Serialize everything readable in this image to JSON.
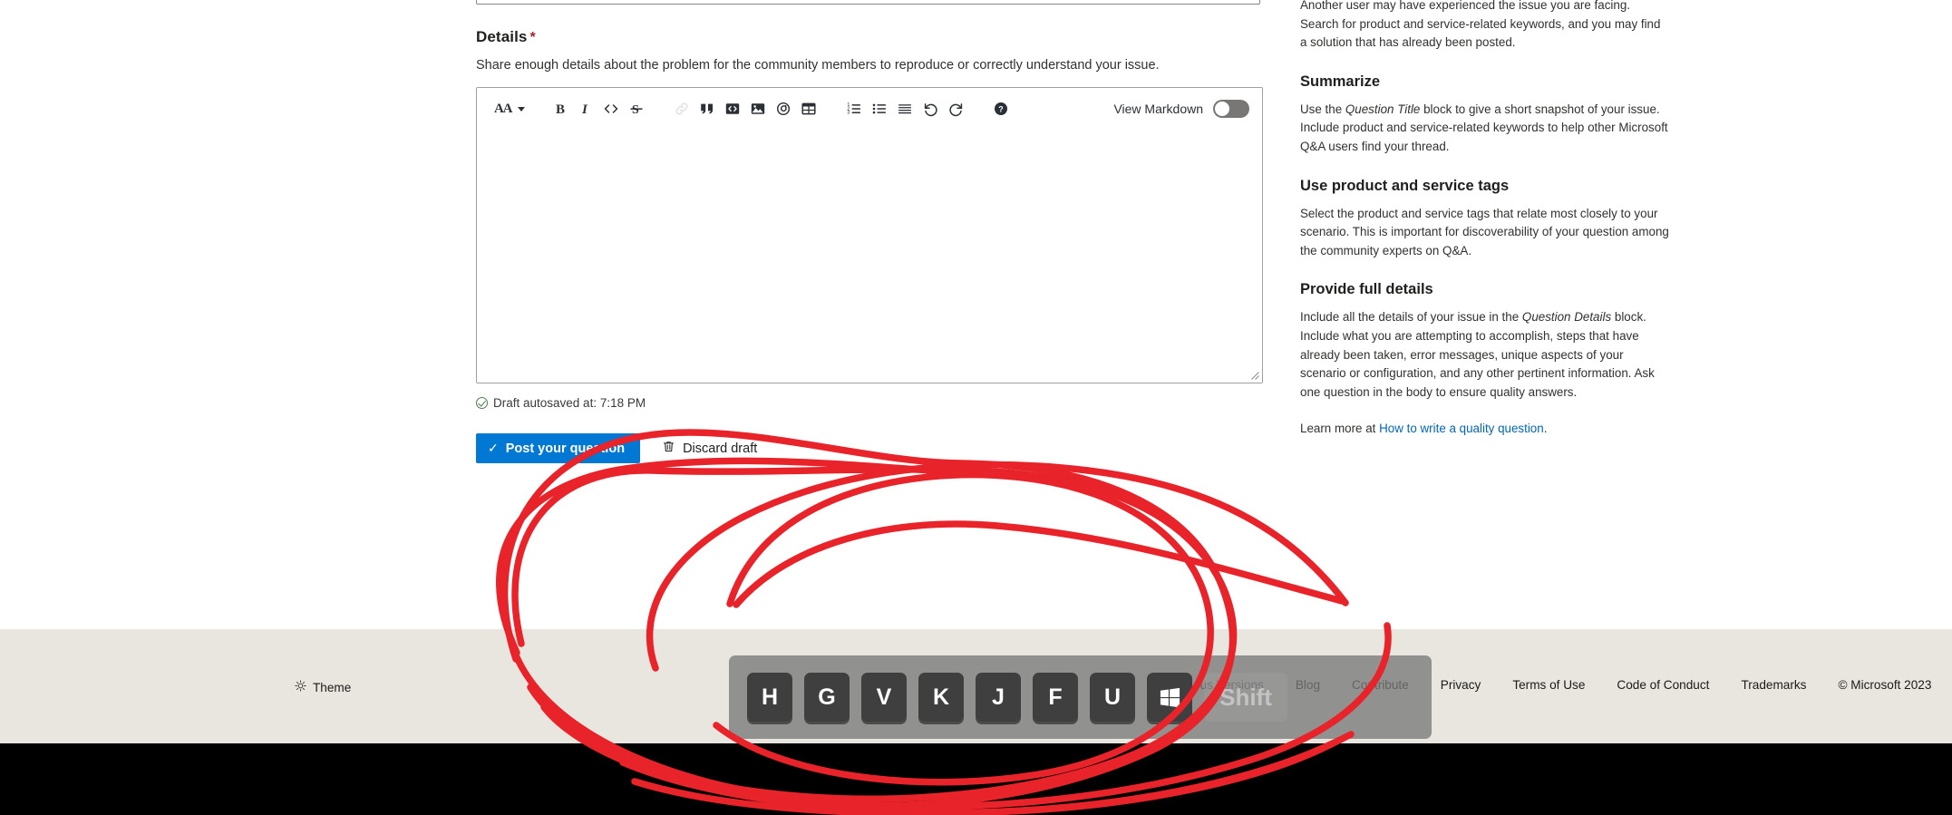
{
  "form": {
    "details_label": "Details",
    "required_marker": "*",
    "details_help": "Share enough details about the problem for the community members to reproduce or correctly understand your issue.",
    "editor": {
      "font_size_label": "AA",
      "view_markdown_label": "View Markdown",
      "view_markdown_on": false,
      "body_value": "",
      "body_placeholder": "",
      "toolbar": [
        {
          "name": "font-size-icon",
          "label": "AA"
        },
        {
          "name": "bold-icon",
          "label": "B"
        },
        {
          "name": "italic-icon",
          "label": "I"
        },
        {
          "name": "code-icon",
          "label": "<>"
        },
        {
          "name": "strikethrough-icon",
          "label": "S"
        },
        {
          "name": "link-icon",
          "label": "Link",
          "disabled": true
        },
        {
          "name": "quote-icon",
          "label": "Quote"
        },
        {
          "name": "code-block-icon",
          "label": "Code block"
        },
        {
          "name": "image-icon",
          "label": "Image"
        },
        {
          "name": "attachment-icon",
          "label": "Attachment"
        },
        {
          "name": "table-icon",
          "label": "Table"
        },
        {
          "name": "ordered-list-icon",
          "label": "Numbered list"
        },
        {
          "name": "unordered-list-icon",
          "label": "Bulleted list"
        },
        {
          "name": "horizontal-rule-icon",
          "label": "Horizontal rule"
        },
        {
          "name": "undo-icon",
          "label": "Undo"
        },
        {
          "name": "redo-icon",
          "label": "Redo"
        },
        {
          "name": "help-icon",
          "label": "Help"
        }
      ]
    },
    "autosave_text": "Draft autosaved at: 7:18 PM",
    "post_button": "Post your question",
    "post_button_check": "✓",
    "discard_button": "Discard draft"
  },
  "guidance": {
    "intro_paragraph": "Another user may have experienced the issue you are facing. Search for product and service-related keywords, and you may find a solution that has already been posted.",
    "sections": [
      {
        "heading": "Summarize",
        "body_start": "Use the ",
        "body_em": "Question Title",
        "body_end": " block to give a short snapshot of your issue. Include product and service-related keywords to help other Microsoft Q&A users find your thread."
      },
      {
        "heading": "Use product and service tags",
        "body_start": "Select the product and service tags that relate most closely to your scenario. This is important for discoverability of your question among the community experts on Q&A.",
        "body_em": "",
        "body_end": ""
      },
      {
        "heading": "Provide full details",
        "body_start": "Include all the details of your issue in the ",
        "body_em": "Question Details",
        "body_end": " block. Include what you are attempting to accomplish, steps that have already been taken, error messages, unique aspects of your scenario or configuration, and any other pertinent information. Ask one question in the body to ensure quality answers."
      }
    ],
    "learn_more_prefix": "Learn more at ",
    "learn_more_link": "How to write a quality question",
    "learn_more_suffix": "."
  },
  "footer": {
    "theme_label": "Theme",
    "links": [
      "Previous Versions",
      "Blog",
      "Contribute",
      "Privacy",
      "Terms of Use",
      "Code of Conduct",
      "Trademarks"
    ],
    "copyright": "© Microsoft 2023"
  },
  "keystroke_overlay": {
    "keys": [
      "H",
      "G",
      "V",
      "K",
      "J",
      "F",
      "U"
    ],
    "win_key_label": "Windows",
    "shift_key_label": "Shift"
  },
  "colors": {
    "accent": "#0078d4",
    "required": "#a4262c",
    "link": "#0067b8",
    "footer_bg": "#e9e6e0",
    "annotation": "#e8232a",
    "key_bg": "#3f3f3f"
  }
}
